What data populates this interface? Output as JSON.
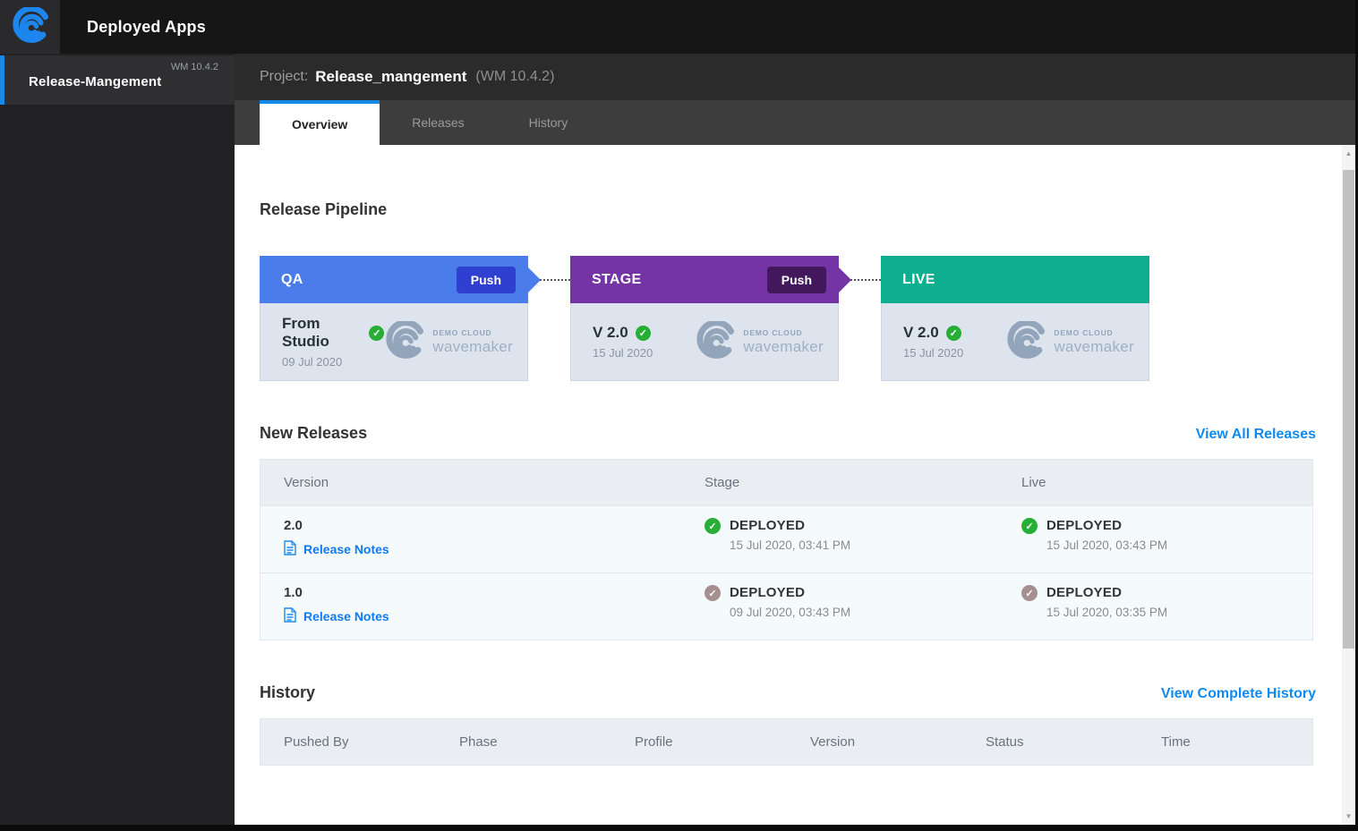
{
  "topbar": {
    "app_title": "Deployed Apps"
  },
  "sidebar": {
    "project": {
      "name": "Release-Mangement",
      "version": "WM 10.4.2"
    }
  },
  "header": {
    "label": "Project:",
    "project_name": "Release_mangement",
    "version": "(WM 10.4.2)"
  },
  "tabs": [
    {
      "label": "Overview",
      "active": true
    },
    {
      "label": "Releases",
      "active": false
    },
    {
      "label": "History",
      "active": false
    }
  ],
  "pipeline": {
    "title": "Release Pipeline",
    "stages": [
      {
        "name": "QA",
        "push_label": "Push",
        "version": "From Studio",
        "date": "09 Jul 2020",
        "header_color": "#4a7de9",
        "push_color": "#2f3fd1",
        "logo_line1": "DEMO CLOUD",
        "logo_line2": "wavemaker"
      },
      {
        "name": "STAGE",
        "push_label": "Push",
        "version": "V 2.0",
        "date": "15 Jul 2020",
        "header_color": "#7434a4",
        "push_color": "#43175c",
        "logo_line1": "DEMO CLOUD",
        "logo_line2": "wavemaker"
      },
      {
        "name": "LIVE",
        "push_label": null,
        "version": "V 2.0",
        "date": "15 Jul 2020",
        "header_color": "#0fae90",
        "push_color": null,
        "logo_line1": "DEMO CLOUD",
        "logo_line2": "wavemaker"
      }
    ]
  },
  "new_releases": {
    "title": "New Releases",
    "view_all_label": "View All Releases",
    "columns": [
      "Version",
      "Stage",
      "Live"
    ],
    "rows": [
      {
        "version": "2.0",
        "notes_label": "Release Notes",
        "stage": {
          "status": "DEPLOYED",
          "time": "15 Jul 2020, 03:41 PM",
          "recent": true
        },
        "live": {
          "status": "DEPLOYED",
          "time": "15 Jul 2020, 03:43 PM",
          "recent": true
        }
      },
      {
        "version": "1.0",
        "notes_label": "Release Notes",
        "stage": {
          "status": "DEPLOYED",
          "time": "09 Jul 2020, 03:43 PM",
          "recent": false
        },
        "live": {
          "status": "DEPLOYED",
          "time": "15 Jul 2020, 03:35 PM",
          "recent": false
        }
      }
    ]
  },
  "history": {
    "title": "History",
    "view_all_label": "View Complete History",
    "columns": [
      "Pushed By",
      "Phase",
      "Profile",
      "Version",
      "Status",
      "Time"
    ]
  },
  "colors": {
    "accent_blue": "#1789e6",
    "link_blue": "#0f8af0",
    "check_recent_green": "#27ae35",
    "check_older_muted": "#a58f8f",
    "qa_header": "#4a7de9",
    "stage_header": "#7434a4",
    "live_header": "#0fae90",
    "card_body_bg": "#dde4ee"
  }
}
